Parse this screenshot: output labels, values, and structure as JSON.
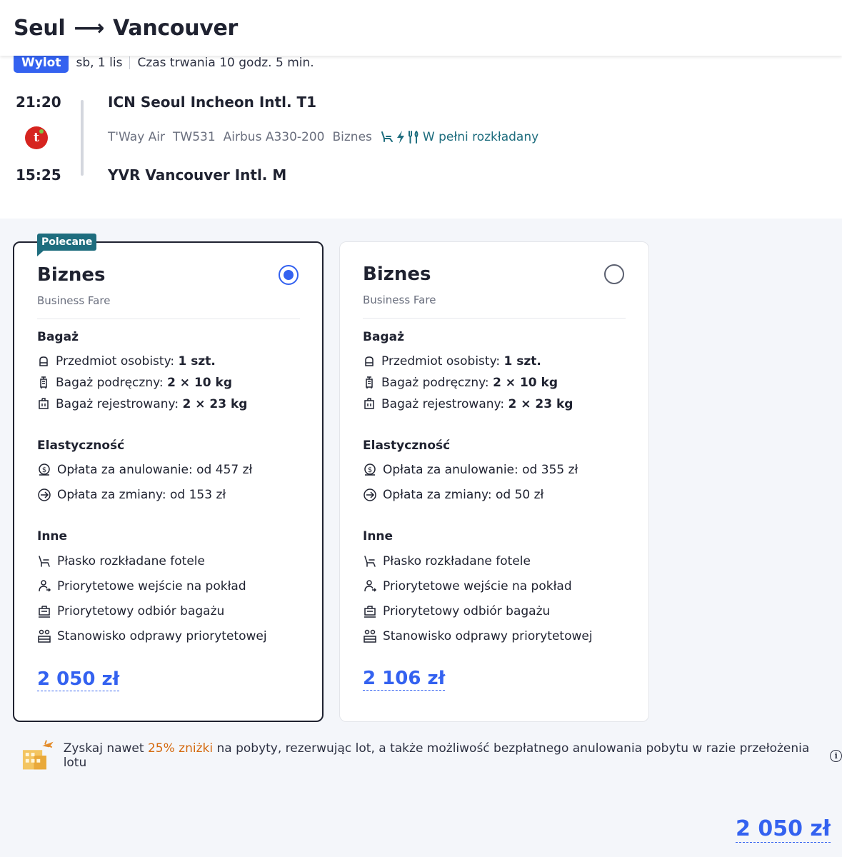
{
  "header": {
    "origin": "Seul",
    "arrow": "⟶",
    "destination": "Vancouver"
  },
  "flight": {
    "badge": "Wylot",
    "date": "sb, 1 lis",
    "duration": "Czas trwania 10 godz. 5 min.",
    "departure_time": "21:20",
    "arrival_time": "15:25",
    "departure_airport": "ICN Seoul Incheon Intl. T1",
    "arrival_airport": "YVR Vancouver Intl. M",
    "airline": "T'Way Air",
    "flight_number": "TW531",
    "aircraft": "Airbus A330-200",
    "cabin": "Biznes",
    "amenity_text": "W pełni rozkładany",
    "airline_logo_letter": "t"
  },
  "fares": [
    {
      "recommended_label": "Polecane",
      "selected": true,
      "name": "Biznes",
      "subtitle": "Business Fare",
      "baggage_title": "Bagaż",
      "personal_label": "Przedmiot osobisty:",
      "personal_value": "1 szt.",
      "cabin_bag_label": "Bagaż podręczny:",
      "cabin_bag_value": "2 × 10 kg",
      "checked_label": "Bagaż rejestrowany:",
      "checked_value": "2 × 23 kg",
      "flex_title": "Elastyczność",
      "cancel_fee": "Opłata za anulowanie: od 457 zł",
      "change_fee": "Opłata za zmiany: od 153 zł",
      "other_title": "Inne",
      "other_1": "Płasko rozkładane fotele",
      "other_2": "Priorytetowe wejście na pokład",
      "other_3": "Priorytetowy odbiór bagażu",
      "other_4": "Stanowisko odprawy priorytetowej",
      "price": "2 050 zł"
    },
    {
      "selected": false,
      "name": "Biznes",
      "subtitle": "Business Fare",
      "baggage_title": "Bagaż",
      "personal_label": "Przedmiot osobisty:",
      "personal_value": "1 szt.",
      "cabin_bag_label": "Bagaż podręczny:",
      "cabin_bag_value": "2 × 10 kg",
      "checked_label": "Bagaż rejestrowany:",
      "checked_value": "2 × 23 kg",
      "flex_title": "Elastyczność",
      "cancel_fee": "Opłata za anulowanie: od 355 zł",
      "change_fee": "Opłata za zmiany: od 50 zł",
      "other_title": "Inne",
      "other_1": "Płasko rozkładane fotele",
      "other_2": "Priorytetowe wejście na pokład",
      "other_3": "Priorytetowy odbiór bagażu",
      "other_4": "Stanowisko odprawy priorytetowej",
      "price": "2 106 zł"
    }
  ],
  "promo": {
    "before": "Zyskaj nawet",
    "highlight": "25% zniżki",
    "after": "na pobyty, rezerwując lot, a także możliwość bezpłatnego anulowania pobytu w razie przełożenia lotu"
  },
  "total_price": "2 050 zł",
  "colors": {
    "accent": "#3462f0",
    "teal": "#1e6d7e",
    "promo": "#d4690f",
    "logo": "#d6241f"
  },
  "icons": [
    "arrow-right-icon",
    "airline-logo-icon",
    "seat-icon",
    "power-icon",
    "meal-icon",
    "personal-item-icon",
    "cabin-bag-icon",
    "checked-bag-icon",
    "cancel-fee-icon",
    "change-fee-icon",
    "flat-seat-icon",
    "priority-boarding-icon",
    "priority-baggage-icon",
    "priority-checkin-icon",
    "hotel-promo-icon",
    "info-icon"
  ]
}
